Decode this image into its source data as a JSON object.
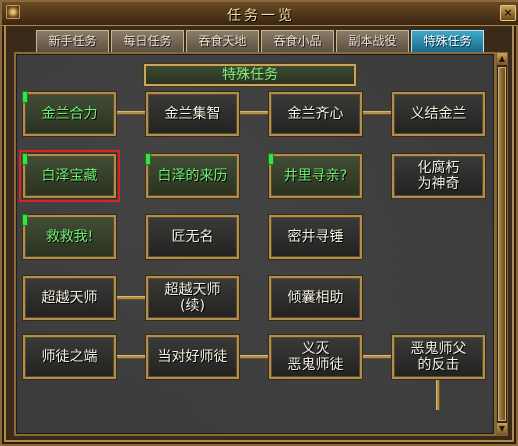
{
  "window": {
    "title": "任务一览",
    "close_glyph": "×"
  },
  "tabs": [
    {
      "label": "新手任务",
      "active": false
    },
    {
      "label": "每日任务",
      "active": false
    },
    {
      "label": "吞食天地",
      "active": false
    },
    {
      "label": "吞食小品",
      "active": false
    },
    {
      "label": "副本战役",
      "active": false
    },
    {
      "label": "特殊任务",
      "active": true
    }
  ],
  "header": {
    "label": "特殊任务"
  },
  "quests": [
    {
      "label": "金兰合力",
      "state": "accepted"
    },
    {
      "label": "金兰集智",
      "state": "normal"
    },
    {
      "label": "金兰齐心",
      "state": "normal"
    },
    {
      "label": "义结金兰",
      "state": "normal"
    },
    {
      "label": "白泽宝藏",
      "state": "selected"
    },
    {
      "label": "白泽的来历",
      "state": "accepted"
    },
    {
      "label": "井里寻亲?",
      "state": "accepted"
    },
    {
      "label": "化腐朽\n为神奇",
      "state": "normal"
    },
    {
      "label": "救救我!",
      "state": "accepted"
    },
    {
      "label": "匠无名",
      "state": "normal"
    },
    {
      "label": "密井寻锤",
      "state": "normal"
    },
    {
      "label": "超越天师",
      "state": "normal"
    },
    {
      "label": "超越天师\n(续)",
      "state": "normal"
    },
    {
      "label": "倾囊相助",
      "state": "normal"
    },
    {
      "label": "师徒之端",
      "state": "normal"
    },
    {
      "label": "当对好师徒",
      "state": "normal"
    },
    {
      "label": "义灭\n恶鬼师徒",
      "state": "normal"
    },
    {
      "label": "恶鬼师父\n的反击",
      "state": "normal"
    }
  ],
  "colors": {
    "accepted_text": "#6ef070",
    "normal_text": "#f4f0e0",
    "active_tab": "#2a8cb0",
    "selection": "#e02020",
    "frame_gold": "#b08e50"
  }
}
